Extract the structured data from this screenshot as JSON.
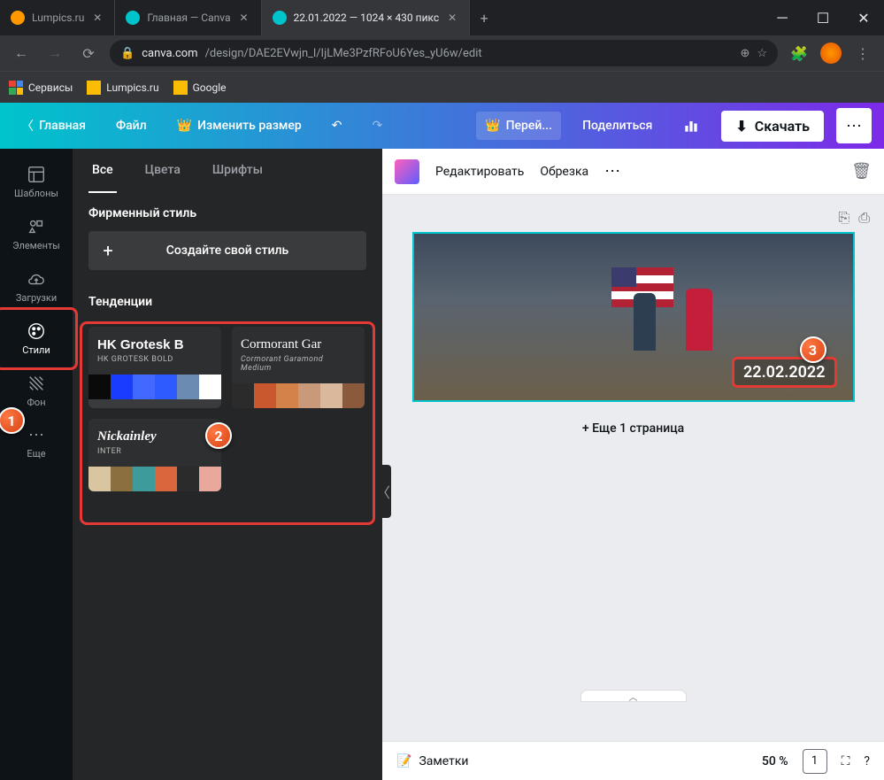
{
  "browser": {
    "tabs": [
      {
        "title": "Lumpics.ru",
        "icon_color": "#ff9800"
      },
      {
        "title": "Главная — Canva",
        "icon_color": "#00c4cc"
      },
      {
        "title": "22.01.2022 — 1024 × 430 пикс",
        "icon_color": "#00c4cc",
        "active": true
      }
    ],
    "url_prefix": "canva.com",
    "url_path": "/design/DAE2EVwjn_l/IjLMe3PzfRFoU6Yes_yU6w/edit",
    "bookmarks": [
      {
        "label": "Сервисы"
      },
      {
        "label": "Lumpics.ru"
      },
      {
        "label": "Google"
      }
    ]
  },
  "topbar": {
    "home": "Главная",
    "file": "Файл",
    "resize": "Изменить размер",
    "upgrade": "Перей...",
    "share": "Поделиться",
    "download": "Скачать"
  },
  "sidebar": {
    "items": [
      {
        "label": "Шаблоны"
      },
      {
        "label": "Элементы"
      },
      {
        "label": "Загрузки"
      },
      {
        "label": "Стили"
      },
      {
        "label": "Фон"
      },
      {
        "label": "Еще"
      }
    ]
  },
  "panel": {
    "tabs": {
      "all": "Все",
      "colors": "Цвета",
      "fonts": "Шрифты"
    },
    "brand_title": "Фирменный стиль",
    "create_label": "Создайте свой стиль",
    "trends_title": "Тенденции",
    "cards": [
      {
        "name": "HK Grotesk B",
        "sub": "HK GROTESK BOLD",
        "palette": [
          "#0a0a0a",
          "#1a3cff",
          "#4169ff",
          "#2e5bff",
          "#6b8bb3",
          "#ffffff"
        ]
      },
      {
        "name": "Cormorant Gar",
        "sub": "Cormorant Garamond Medium",
        "palette": [
          "#2b2b2b",
          "#c9582e",
          "#d4814a",
          "#c99a7a",
          "#d9b89c",
          "#8b5a3c"
        ]
      },
      {
        "name": "Nickainley",
        "sub": "INTER",
        "palette": [
          "#d9c5a0",
          "#8b6f3e",
          "#3d9b9b",
          "#d9663d",
          "#2b2b2b",
          "#e8a89c"
        ]
      }
    ]
  },
  "canvas_toolbar": {
    "edit": "Редактировать",
    "crop": "Обрезка"
  },
  "canvas": {
    "date_text": "22.02.2022",
    "add_page": "+ Еще 1 страница"
  },
  "bottom": {
    "notes": "Заметки",
    "zoom": "50 %",
    "page": "1"
  },
  "markers": {
    "m1": "1",
    "m2": "2",
    "m3": "3"
  }
}
